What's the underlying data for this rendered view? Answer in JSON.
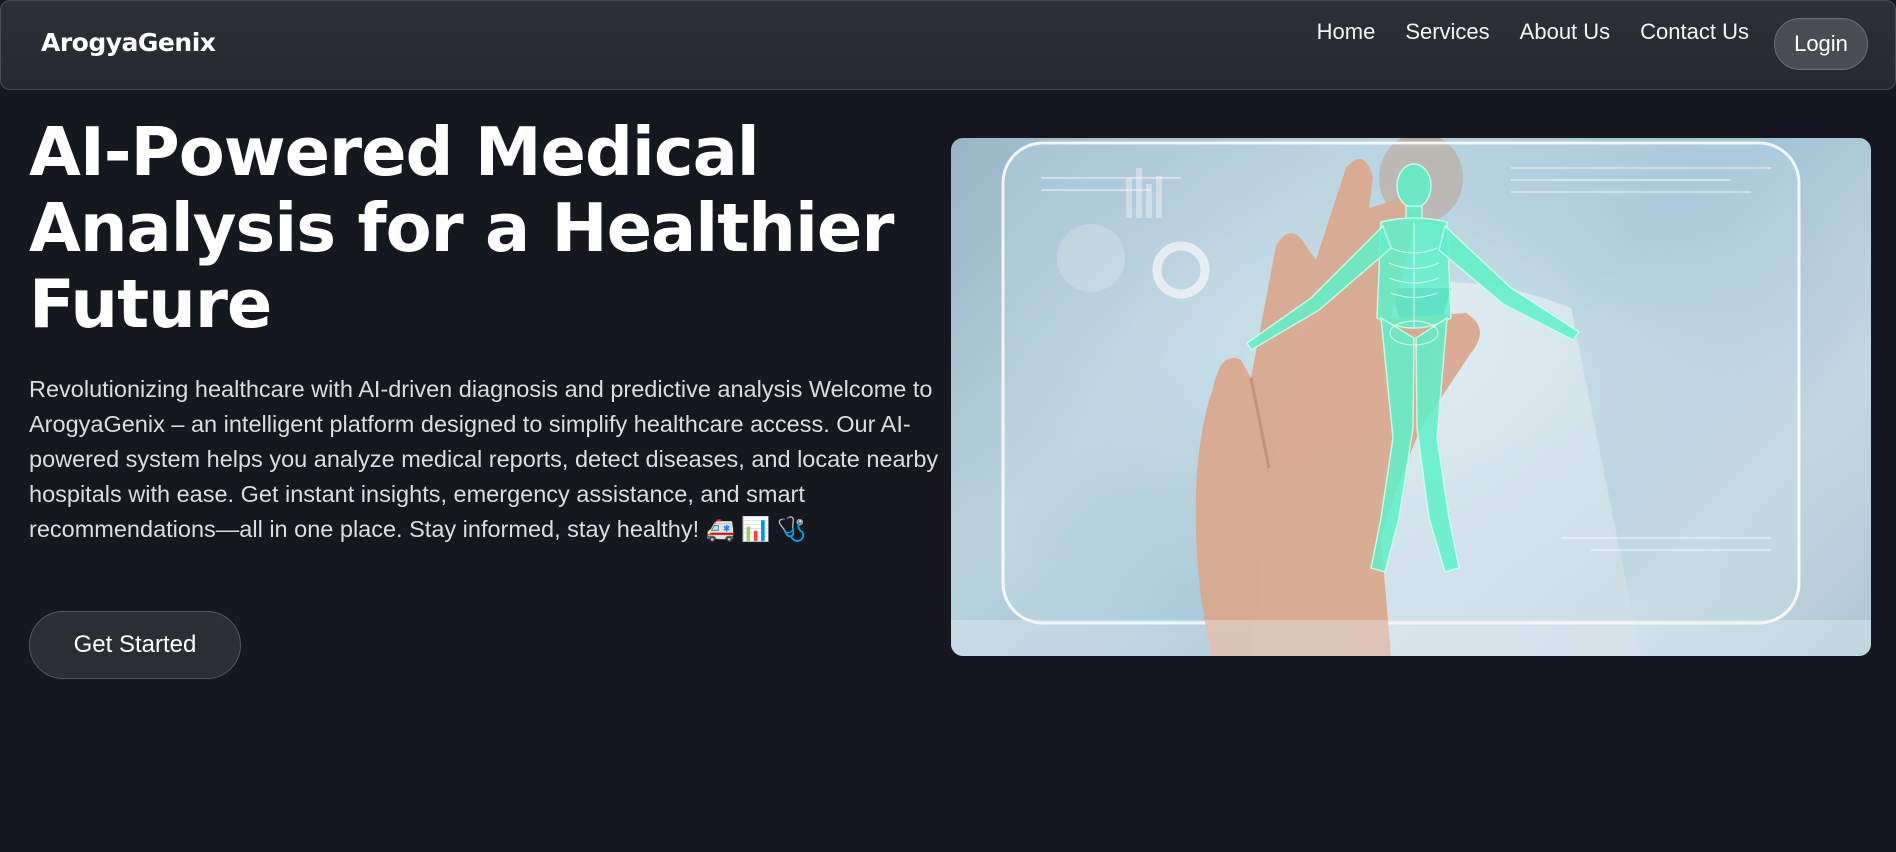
{
  "navbar": {
    "brand": "ArogyaGenix",
    "links": [
      "Home",
      "Services",
      "About Us",
      "Contact Us"
    ],
    "login_label": "Login"
  },
  "hero": {
    "title_lines": [
      "AI-Powered Medical",
      "Analysis for a Healthier",
      "Future"
    ],
    "description": "Revolutionizing healthcare with AI-driven diagnosis and predictive analysis Welcome to ArogyaGenix – an intelligent platform designed to simplify healthcare access. Our AI-powered system helps you analyze medical reports, detect diseases, and locate nearby hospitals with ease. Get instant insights, emergency assistance, and smart recommendations—all in one place. Stay informed, stay healthy! 🚑 📊 🩺",
    "cta_label": "Get Started",
    "image_icon": "hologram-human-body-illustration"
  },
  "colors": {
    "background": "#161820",
    "navbar": "#2a2d34",
    "hologram": "#5ff0c8"
  }
}
